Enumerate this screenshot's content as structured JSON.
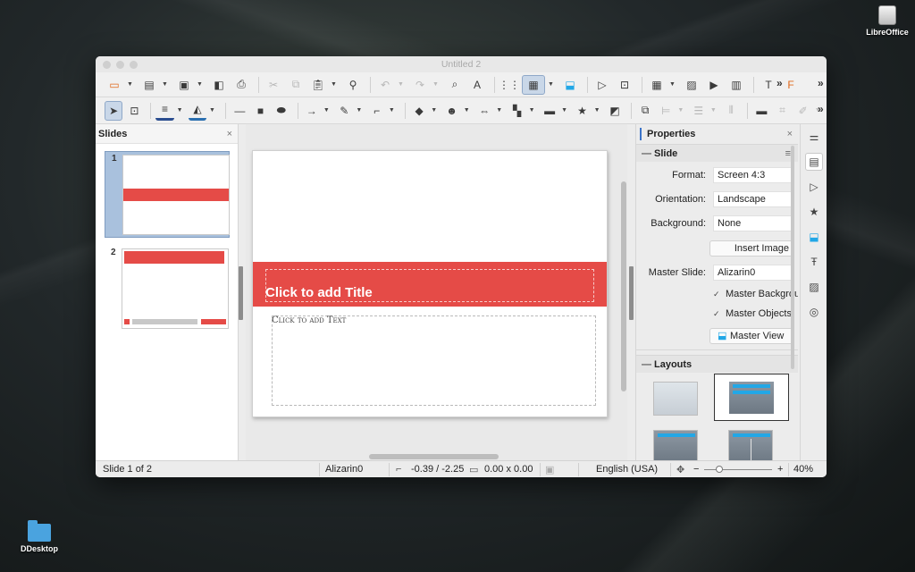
{
  "desktop": {
    "drive_label": "LibreOffice",
    "folder_label": "DDesktop"
  },
  "window": {
    "title": "Untitled 2"
  },
  "toolbar1": {
    "icons": [
      "presentation-start",
      "open",
      "save",
      "export-pdf",
      "print",
      "cut",
      "copy",
      "paste",
      "clone-formatting",
      "undo",
      "redo",
      "find",
      "spelling",
      "grid",
      "display-views",
      "master-slide",
      "start-from-first",
      "start-from-current",
      "table",
      "image",
      "media",
      "chart",
      "text-box",
      "fontwork"
    ],
    "more": "»"
  },
  "toolbar2": {
    "icons": [
      "select",
      "zoom-pan",
      "line-color",
      "fill-color",
      "line",
      "rectangle",
      "ellipse",
      "arrows",
      "curves",
      "connectors",
      "basic-shapes",
      "symbol-shapes",
      "block-arrows",
      "flowchart",
      "callouts",
      "stars",
      "3d-objects",
      "rotate",
      "align",
      "arrange",
      "distribute",
      "shadow",
      "crop",
      "filter"
    ],
    "more": "»"
  },
  "slides_pane": {
    "title": "Slides",
    "close": "×",
    "slides": [
      {
        "number": "1",
        "selected": true
      },
      {
        "number": "2",
        "selected": false
      }
    ]
  },
  "slide": {
    "title_placeholder": "Click to add Title",
    "body_placeholder": "Click to add Text"
  },
  "properties": {
    "title": "Properties",
    "close": "×",
    "slide_section": {
      "title": "Slide",
      "format_label": "Format:",
      "format_value": "Screen 4:3",
      "orientation_label": "Orientation:",
      "orientation_value": "Landscape",
      "background_label": "Background:",
      "background_value": "None",
      "insert_image": "Insert Image",
      "master_slide_label": "Master Slide:",
      "master_slide_value": "Alizarin0",
      "master_background": "Master Background",
      "master_objects": "Master Objects",
      "master_view": "Master View"
    },
    "layouts_section": {
      "title": "Layouts"
    }
  },
  "statusbar": {
    "slide_info": "Slide 1 of 2",
    "master": "Alizarin0",
    "position": "-0.39 / -2.25",
    "size": "0.00 x 0.00",
    "language": "English (USA)",
    "zoom_minus": "−",
    "zoom_plus": "+",
    "zoom": "40%"
  },
  "colors": {
    "accent_red": "#e54b47",
    "selection_blue": "#a9c1dd",
    "layout_blue": "#22a7e6"
  }
}
